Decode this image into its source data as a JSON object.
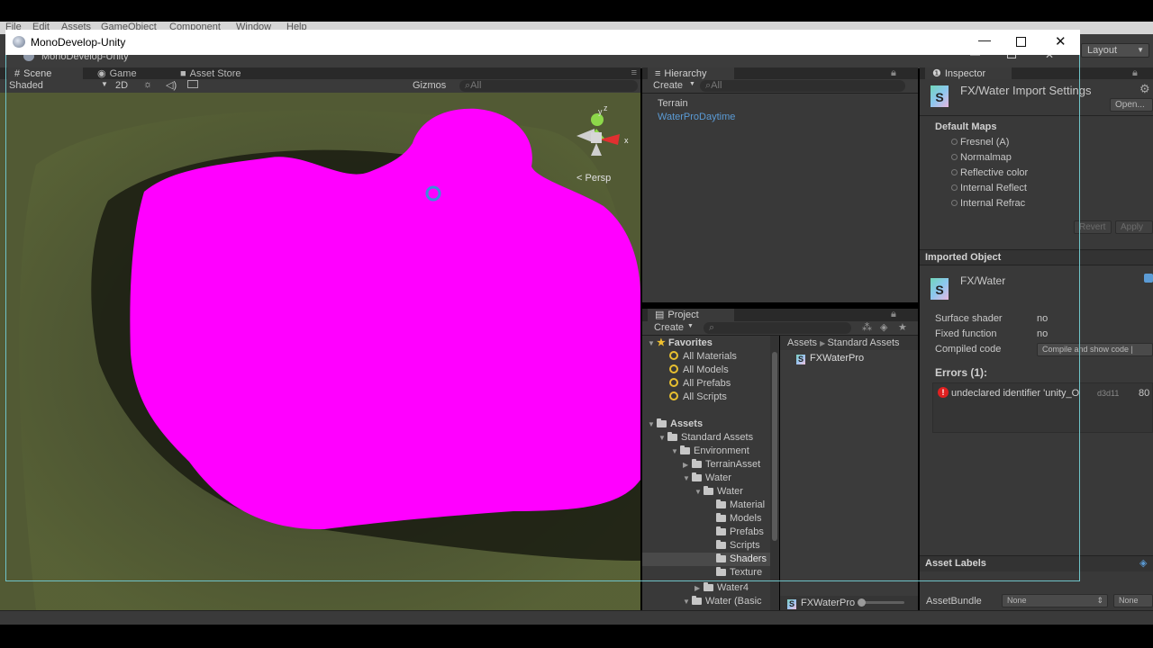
{
  "unity_menu": [
    "File",
    "Edit",
    "Assets",
    "GameObject",
    "Component",
    "Window",
    "Help"
  ],
  "window": {
    "title": "MonoDevelop-Unity",
    "shadow_title": "MonoDevelop-Unity"
  },
  "toolbar": {
    "layout": "Layout"
  },
  "scene": {
    "tabs": [
      "Scene",
      "Game",
      "Asset Store"
    ],
    "shading": "Shaded",
    "mode_2d": "2D",
    "gizmos": "Gizmos",
    "search": "All",
    "persp": "Persp",
    "gizmo_axes": {
      "y": "y",
      "z": "z",
      "x": "x"
    },
    "colors": {
      "missing_shader": "#ff00ff",
      "terrain": "#4a5230"
    }
  },
  "hierarchy": {
    "tab": "Hierarchy",
    "create": "Create",
    "search": "All",
    "items": [
      "Terrain",
      "WaterProDaytime"
    ],
    "prefab_color": "#5b9bd5"
  },
  "project": {
    "tab": "Project",
    "create": "Create",
    "favorites": {
      "label": "Favorites",
      "items": [
        "All Materials",
        "All Models",
        "All Prefabs",
        "All Scripts"
      ]
    },
    "assets_label": "Assets",
    "tree": [
      "Standard Assets",
      "Environment",
      "TerrainAsset",
      "Water",
      "Water",
      "Material",
      "Models",
      "Prefabs",
      "Scripts",
      "Shaders",
      "Texture",
      "Water4",
      "Water (Basic"
    ],
    "breadcrumb": [
      "Assets",
      "Standard Assets"
    ],
    "files": [
      "FXWaterPro"
    ],
    "footer_file": "FXWaterPro"
  },
  "inspector": {
    "tab": "Inspector",
    "title": "FX/Water Import Settings",
    "open": "Open...",
    "default_maps": "Default Maps",
    "maps": [
      "Fresnel (A)",
      "Normalmap",
      "Reflective color",
      "Internal Reflect",
      "Internal Refrac"
    ],
    "revert": "Revert",
    "apply": "Apply",
    "imported_object": "Imported Object",
    "object_name": "FX/Water",
    "props": [
      {
        "label": "Surface shader",
        "value": "no"
      },
      {
        "label": "Fixed function",
        "value": "no"
      },
      {
        "label": "Compiled code",
        "value": "Compile and show code  |"
      }
    ],
    "errors_header": "Errors (1):",
    "error": {
      "message": "undeclared identifier 'unity_O",
      "platform": "d3d11",
      "line": "80"
    },
    "asset_labels": "Asset Labels",
    "asset_bundle": "AssetBundle",
    "bundle_none": "None",
    "bundle_variant": "None"
  },
  "icons": [
    "unity-logo-icon",
    "maximize-icon",
    "minimize-icon",
    "close-icon",
    "folder-icon",
    "search-icon",
    "star-icon",
    "shader-icon",
    "error-icon",
    "lock-icon",
    "menu-icon",
    "sun-icon",
    "audio-icon",
    "image-icon",
    "gear-icon",
    "tag-icon"
  ]
}
